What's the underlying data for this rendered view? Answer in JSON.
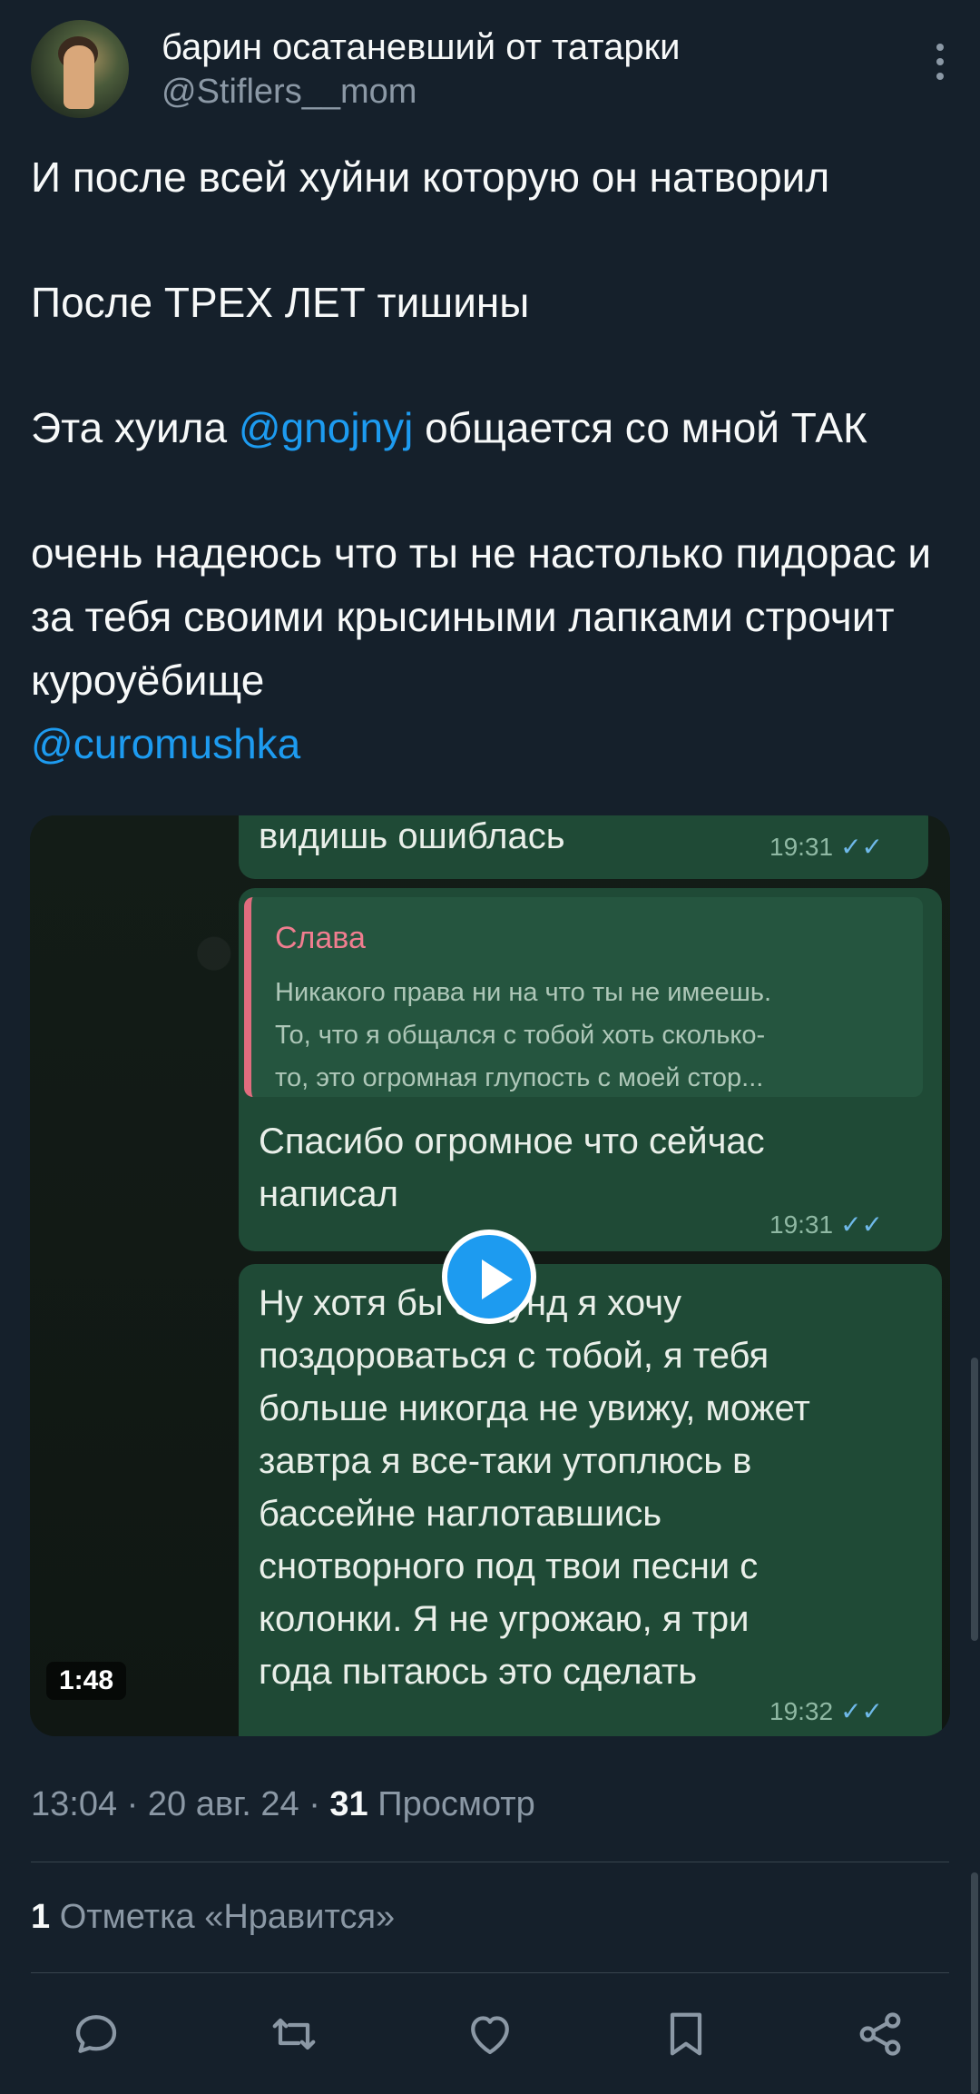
{
  "author": {
    "name": "барин осатаневший от татарки",
    "handle": "@Stiflers__mom"
  },
  "tweet": {
    "line1": "И после всей хуйни которую он натворил",
    "line2": "После ТРЕХ ЛЕТ тишины",
    "line3_prefix": "Эта хуила",
    "mention1": "@gnojnyj",
    "line3_suffix": "общается со мной ТАК",
    "line4": "очень надеюсь что ты не настолько пидорас и за тебя своими крысиными лапками строчит куроуёбище",
    "mention2": "@curomushka"
  },
  "video": {
    "duration": "1:48",
    "messages": [
      {
        "text": "видишь ошиблась",
        "time": "19:31"
      },
      {
        "quote_name": "Слава",
        "quote_text": "Никакого права ни на что ты не имеешь.\nТо, что я общался с тобой хоть сколько-\nто, это огромная глупость с моей стор...",
        "text": "Спасибо огромное что сейчас\nнаписал",
        "time": "19:31"
      },
      {
        "text": "Ну хотя бы секунд я хочу\nпоздороваться с тобой, я тебя\nбольше никогда не увижу, может\nзавтра я все-таки утоплюсь в\nбассейне наглотавшись\nснотворного под твои песни с\nколонки. Я не угрожаю, я три\nгода пытаюсь это сделать",
        "time": "19:32"
      }
    ],
    "ticks": "✓✓"
  },
  "meta": {
    "time": "13:04",
    "date": "20 авг. 24",
    "views_count": "31",
    "views_label": "Просмотр",
    "separator": "·"
  },
  "likes": {
    "count": "1",
    "label": "Отметка «Нравится»"
  },
  "colors": {
    "background": "#15202b",
    "accent": "#1d9bf0",
    "muted": "#8b98a5"
  },
  "actions": [
    "reply-icon",
    "retweet-icon",
    "like-icon",
    "bookmark-icon",
    "share-icon"
  ]
}
